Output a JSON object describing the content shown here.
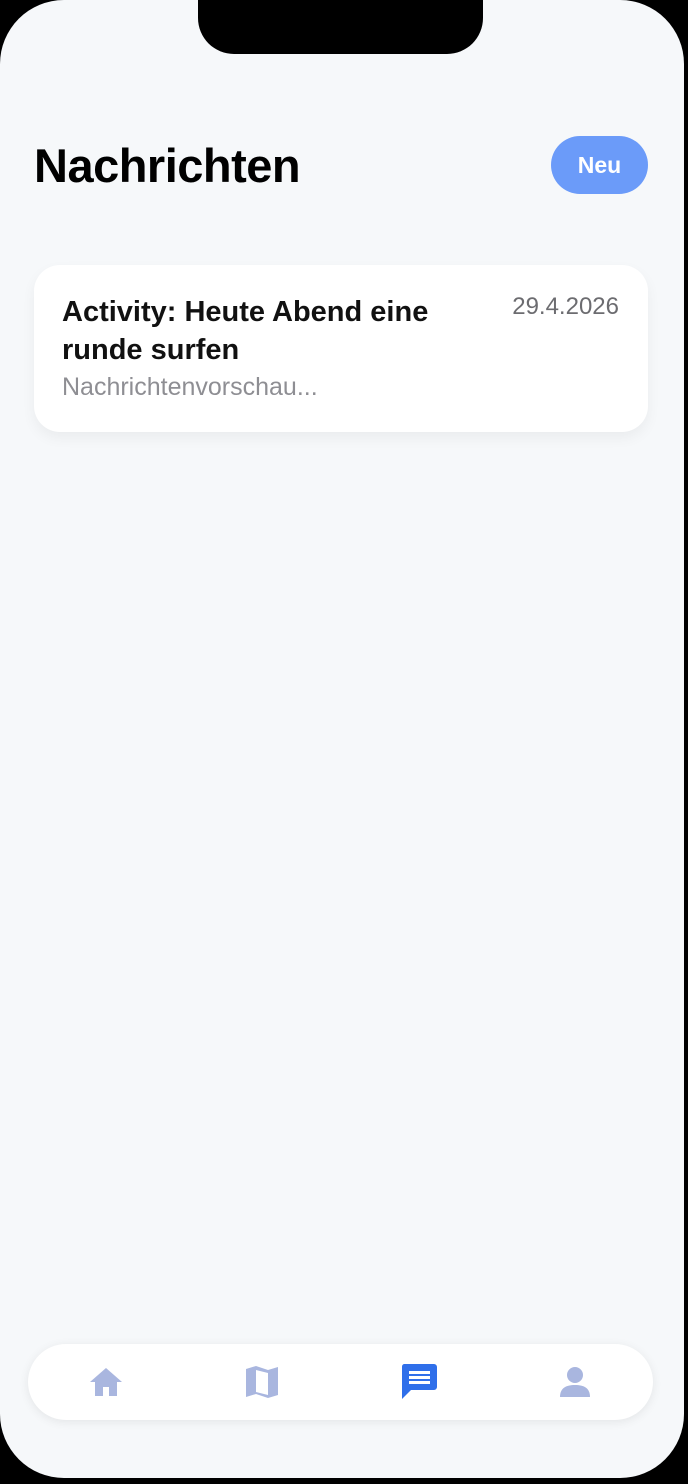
{
  "header": {
    "title": "Nachrichten",
    "new_button_label": "Neu"
  },
  "messages": [
    {
      "title": "Activity: Heute Abend eine runde surfen",
      "date": "29.4.2026",
      "preview": "Nachrichtenvorschau..."
    }
  ],
  "tab_bar": {
    "items": [
      {
        "icon": "home-icon",
        "active": false
      },
      {
        "icon": "map-icon",
        "active": false
      },
      {
        "icon": "chat-icon",
        "active": true
      },
      {
        "icon": "person-icon",
        "active": false
      }
    ]
  },
  "colors": {
    "background": "#f6f8fa",
    "accent": "#6b9bf9",
    "tab_active": "#2f6fea",
    "tab_inactive": "#a9b6df"
  }
}
